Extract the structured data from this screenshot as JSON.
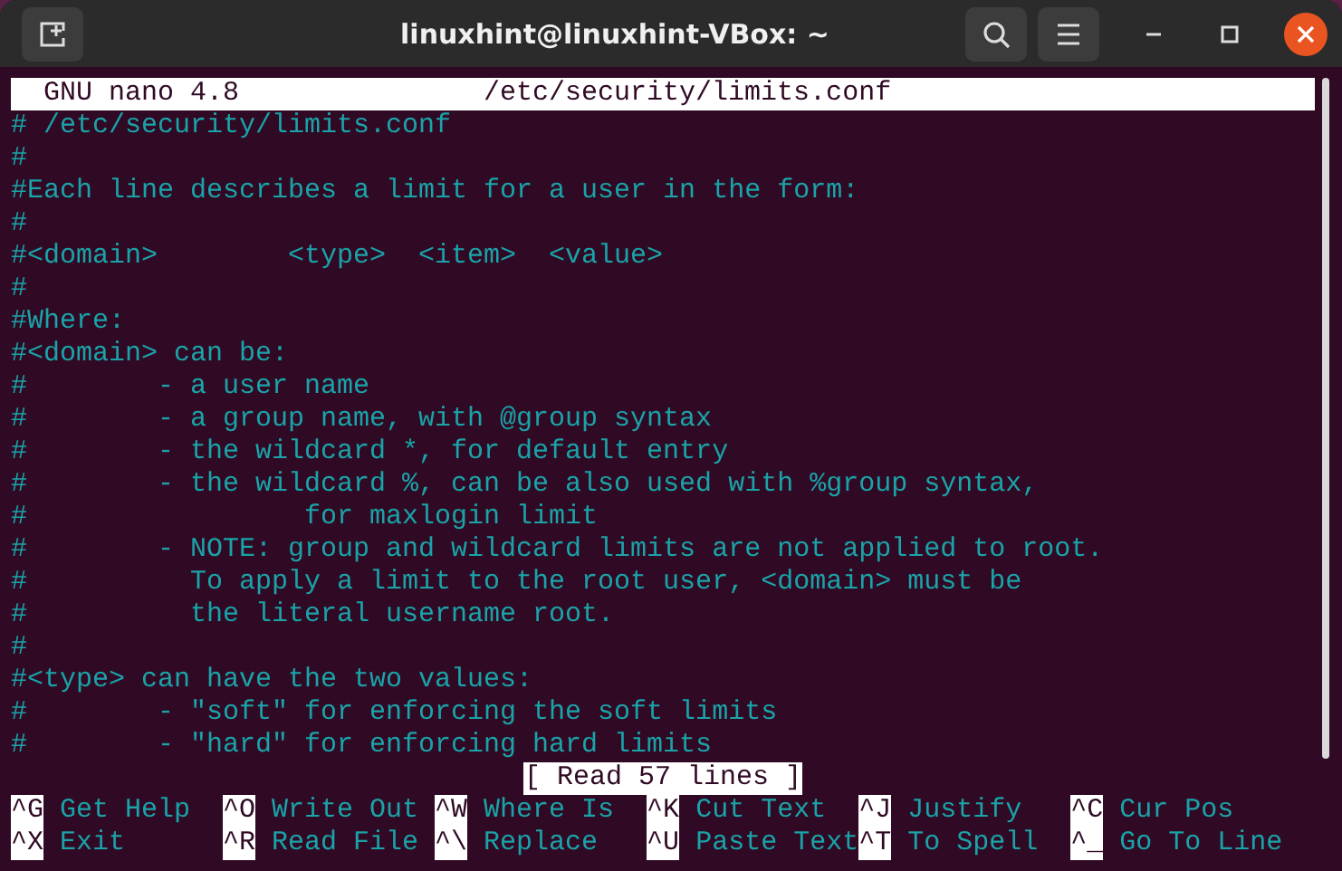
{
  "window": {
    "title": "linuxhint@linuxhint-VBox: ~"
  },
  "editor": {
    "name": "GNU nano 4.8",
    "file": "/etc/security/limits.conf"
  },
  "lines": [
    "# /etc/security/limits.conf",
    "#",
    "#Each line describes a limit for a user in the form:",
    "#",
    "#<domain>        <type>  <item>  <value>",
    "#",
    "#Where:",
    "#<domain> can be:",
    "#        - a user name",
    "#        - a group name, with @group syntax",
    "#        - the wildcard *, for default entry",
    "#        - the wildcard %, can be also used with %group syntax,",
    "#                 for maxlogin limit",
    "#        - NOTE: group and wildcard limits are not applied to root.",
    "#          To apply a limit to the root user, <domain> must be",
    "#          the literal username root.",
    "#",
    "#<type> can have the two values:",
    "#        - \"soft\" for enforcing the soft limits",
    "#        - \"hard\" for enforcing hard limits"
  ],
  "status": "[ Read 57 lines ]",
  "shortcuts": [
    [
      {
        "key": "^G",
        "label": "Get Help"
      },
      {
        "key": "^O",
        "label": "Write Out"
      },
      {
        "key": "^W",
        "label": "Where Is"
      },
      {
        "key": "^K",
        "label": "Cut Text"
      },
      {
        "key": "^J",
        "label": "Justify"
      },
      {
        "key": "^C",
        "label": "Cur Pos"
      }
    ],
    [
      {
        "key": "^X",
        "label": "Exit"
      },
      {
        "key": "^R",
        "label": "Read File"
      },
      {
        "key": "^\\",
        "label": "Replace"
      },
      {
        "key": "^U",
        "label": "Paste Text"
      },
      {
        "key": "^T",
        "label": "To Spell"
      },
      {
        "key": "^_",
        "label": "Go To Line"
      }
    ]
  ]
}
